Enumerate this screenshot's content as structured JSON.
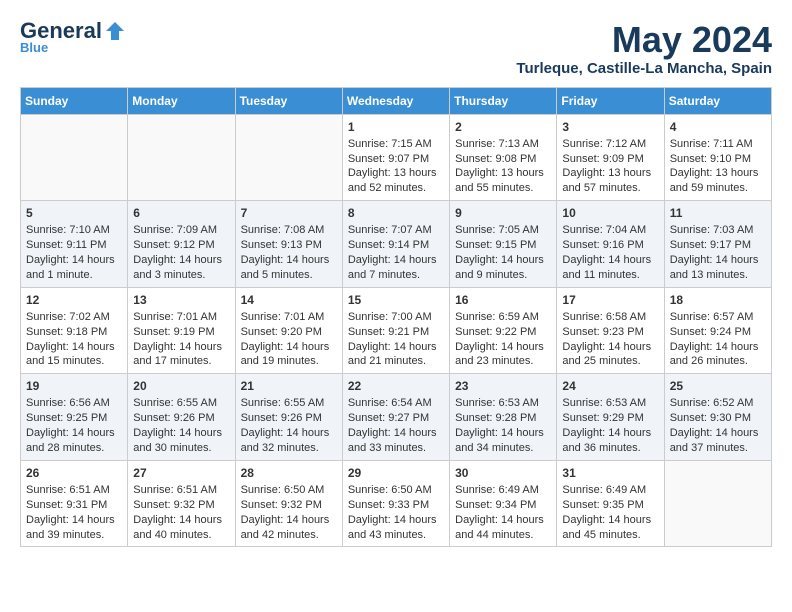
{
  "header": {
    "logo_general": "General",
    "logo_blue": "Blue",
    "month": "May 2024",
    "location": "Turleque, Castille-La Mancha, Spain"
  },
  "days_of_week": [
    "Sunday",
    "Monday",
    "Tuesday",
    "Wednesday",
    "Thursday",
    "Friday",
    "Saturday"
  ],
  "weeks": [
    [
      {
        "day": "",
        "sunrise": "",
        "sunset": "",
        "daylight": ""
      },
      {
        "day": "",
        "sunrise": "",
        "sunset": "",
        "daylight": ""
      },
      {
        "day": "",
        "sunrise": "",
        "sunset": "",
        "daylight": ""
      },
      {
        "day": "1",
        "sunrise": "7:15 AM",
        "sunset": "9:07 PM",
        "daylight": "13 hours and 52 minutes."
      },
      {
        "day": "2",
        "sunrise": "7:13 AM",
        "sunset": "9:08 PM",
        "daylight": "13 hours and 55 minutes."
      },
      {
        "day": "3",
        "sunrise": "7:12 AM",
        "sunset": "9:09 PM",
        "daylight": "13 hours and 57 minutes."
      },
      {
        "day": "4",
        "sunrise": "7:11 AM",
        "sunset": "9:10 PM",
        "daylight": "13 hours and 59 minutes."
      }
    ],
    [
      {
        "day": "5",
        "sunrise": "7:10 AM",
        "sunset": "9:11 PM",
        "daylight": "14 hours and 1 minute."
      },
      {
        "day": "6",
        "sunrise": "7:09 AM",
        "sunset": "9:12 PM",
        "daylight": "14 hours and 3 minutes."
      },
      {
        "day": "7",
        "sunrise": "7:08 AM",
        "sunset": "9:13 PM",
        "daylight": "14 hours and 5 minutes."
      },
      {
        "day": "8",
        "sunrise": "7:07 AM",
        "sunset": "9:14 PM",
        "daylight": "14 hours and 7 minutes."
      },
      {
        "day": "9",
        "sunrise": "7:05 AM",
        "sunset": "9:15 PM",
        "daylight": "14 hours and 9 minutes."
      },
      {
        "day": "10",
        "sunrise": "7:04 AM",
        "sunset": "9:16 PM",
        "daylight": "14 hours and 11 minutes."
      },
      {
        "day": "11",
        "sunrise": "7:03 AM",
        "sunset": "9:17 PM",
        "daylight": "14 hours and 13 minutes."
      }
    ],
    [
      {
        "day": "12",
        "sunrise": "7:02 AM",
        "sunset": "9:18 PM",
        "daylight": "14 hours and 15 minutes."
      },
      {
        "day": "13",
        "sunrise": "7:01 AM",
        "sunset": "9:19 PM",
        "daylight": "14 hours and 17 minutes."
      },
      {
        "day": "14",
        "sunrise": "7:01 AM",
        "sunset": "9:20 PM",
        "daylight": "14 hours and 19 minutes."
      },
      {
        "day": "15",
        "sunrise": "7:00 AM",
        "sunset": "9:21 PM",
        "daylight": "14 hours and 21 minutes."
      },
      {
        "day": "16",
        "sunrise": "6:59 AM",
        "sunset": "9:22 PM",
        "daylight": "14 hours and 23 minutes."
      },
      {
        "day": "17",
        "sunrise": "6:58 AM",
        "sunset": "9:23 PM",
        "daylight": "14 hours and 25 minutes."
      },
      {
        "day": "18",
        "sunrise": "6:57 AM",
        "sunset": "9:24 PM",
        "daylight": "14 hours and 26 minutes."
      }
    ],
    [
      {
        "day": "19",
        "sunrise": "6:56 AM",
        "sunset": "9:25 PM",
        "daylight": "14 hours and 28 minutes."
      },
      {
        "day": "20",
        "sunrise": "6:55 AM",
        "sunset": "9:26 PM",
        "daylight": "14 hours and 30 minutes."
      },
      {
        "day": "21",
        "sunrise": "6:55 AM",
        "sunset": "9:26 PM",
        "daylight": "14 hours and 32 minutes."
      },
      {
        "day": "22",
        "sunrise": "6:54 AM",
        "sunset": "9:27 PM",
        "daylight": "14 hours and 33 minutes."
      },
      {
        "day": "23",
        "sunrise": "6:53 AM",
        "sunset": "9:28 PM",
        "daylight": "14 hours and 34 minutes."
      },
      {
        "day": "24",
        "sunrise": "6:53 AM",
        "sunset": "9:29 PM",
        "daylight": "14 hours and 36 minutes."
      },
      {
        "day": "25",
        "sunrise": "6:52 AM",
        "sunset": "9:30 PM",
        "daylight": "14 hours and 37 minutes."
      }
    ],
    [
      {
        "day": "26",
        "sunrise": "6:51 AM",
        "sunset": "9:31 PM",
        "daylight": "14 hours and 39 minutes."
      },
      {
        "day": "27",
        "sunrise": "6:51 AM",
        "sunset": "9:32 PM",
        "daylight": "14 hours and 40 minutes."
      },
      {
        "day": "28",
        "sunrise": "6:50 AM",
        "sunset": "9:32 PM",
        "daylight": "14 hours and 42 minutes."
      },
      {
        "day": "29",
        "sunrise": "6:50 AM",
        "sunset": "9:33 PM",
        "daylight": "14 hours and 43 minutes."
      },
      {
        "day": "30",
        "sunrise": "6:49 AM",
        "sunset": "9:34 PM",
        "daylight": "14 hours and 44 minutes."
      },
      {
        "day": "31",
        "sunrise": "6:49 AM",
        "sunset": "9:35 PM",
        "daylight": "14 hours and 45 minutes."
      },
      {
        "day": "",
        "sunrise": "",
        "sunset": "",
        "daylight": ""
      }
    ]
  ]
}
